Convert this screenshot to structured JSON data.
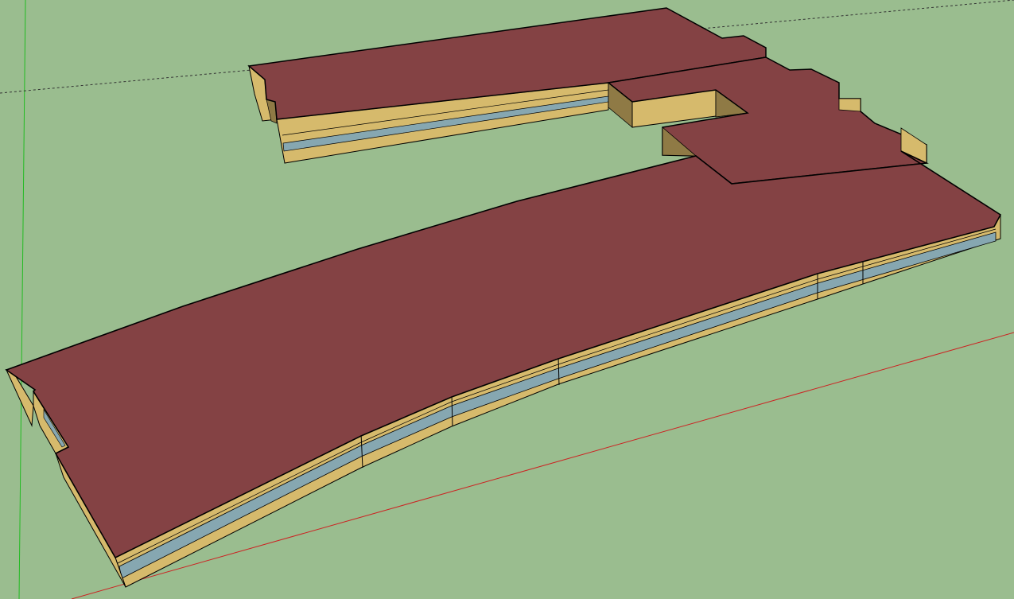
{
  "app": {
    "type": "3d-modeling-viewport"
  },
  "colors": {
    "ground": "#9abd8f",
    "roof": "#844244",
    "wall_tan": "#d6ba6c",
    "wall_shadow": "#8f7a45",
    "glazing": "#86a7b1",
    "edge": "#000000",
    "axis_green": "#22bb22",
    "axis_red": "#cc2222",
    "axis_dashed": "#333333"
  },
  "model": {
    "blocks": [
      "main-curved-wing",
      "north-wing",
      "connector-block",
      "courtyard-void"
    ],
    "icons": [
      "x-axis-line",
      "y-axis-line",
      "z-axis-line"
    ]
  }
}
